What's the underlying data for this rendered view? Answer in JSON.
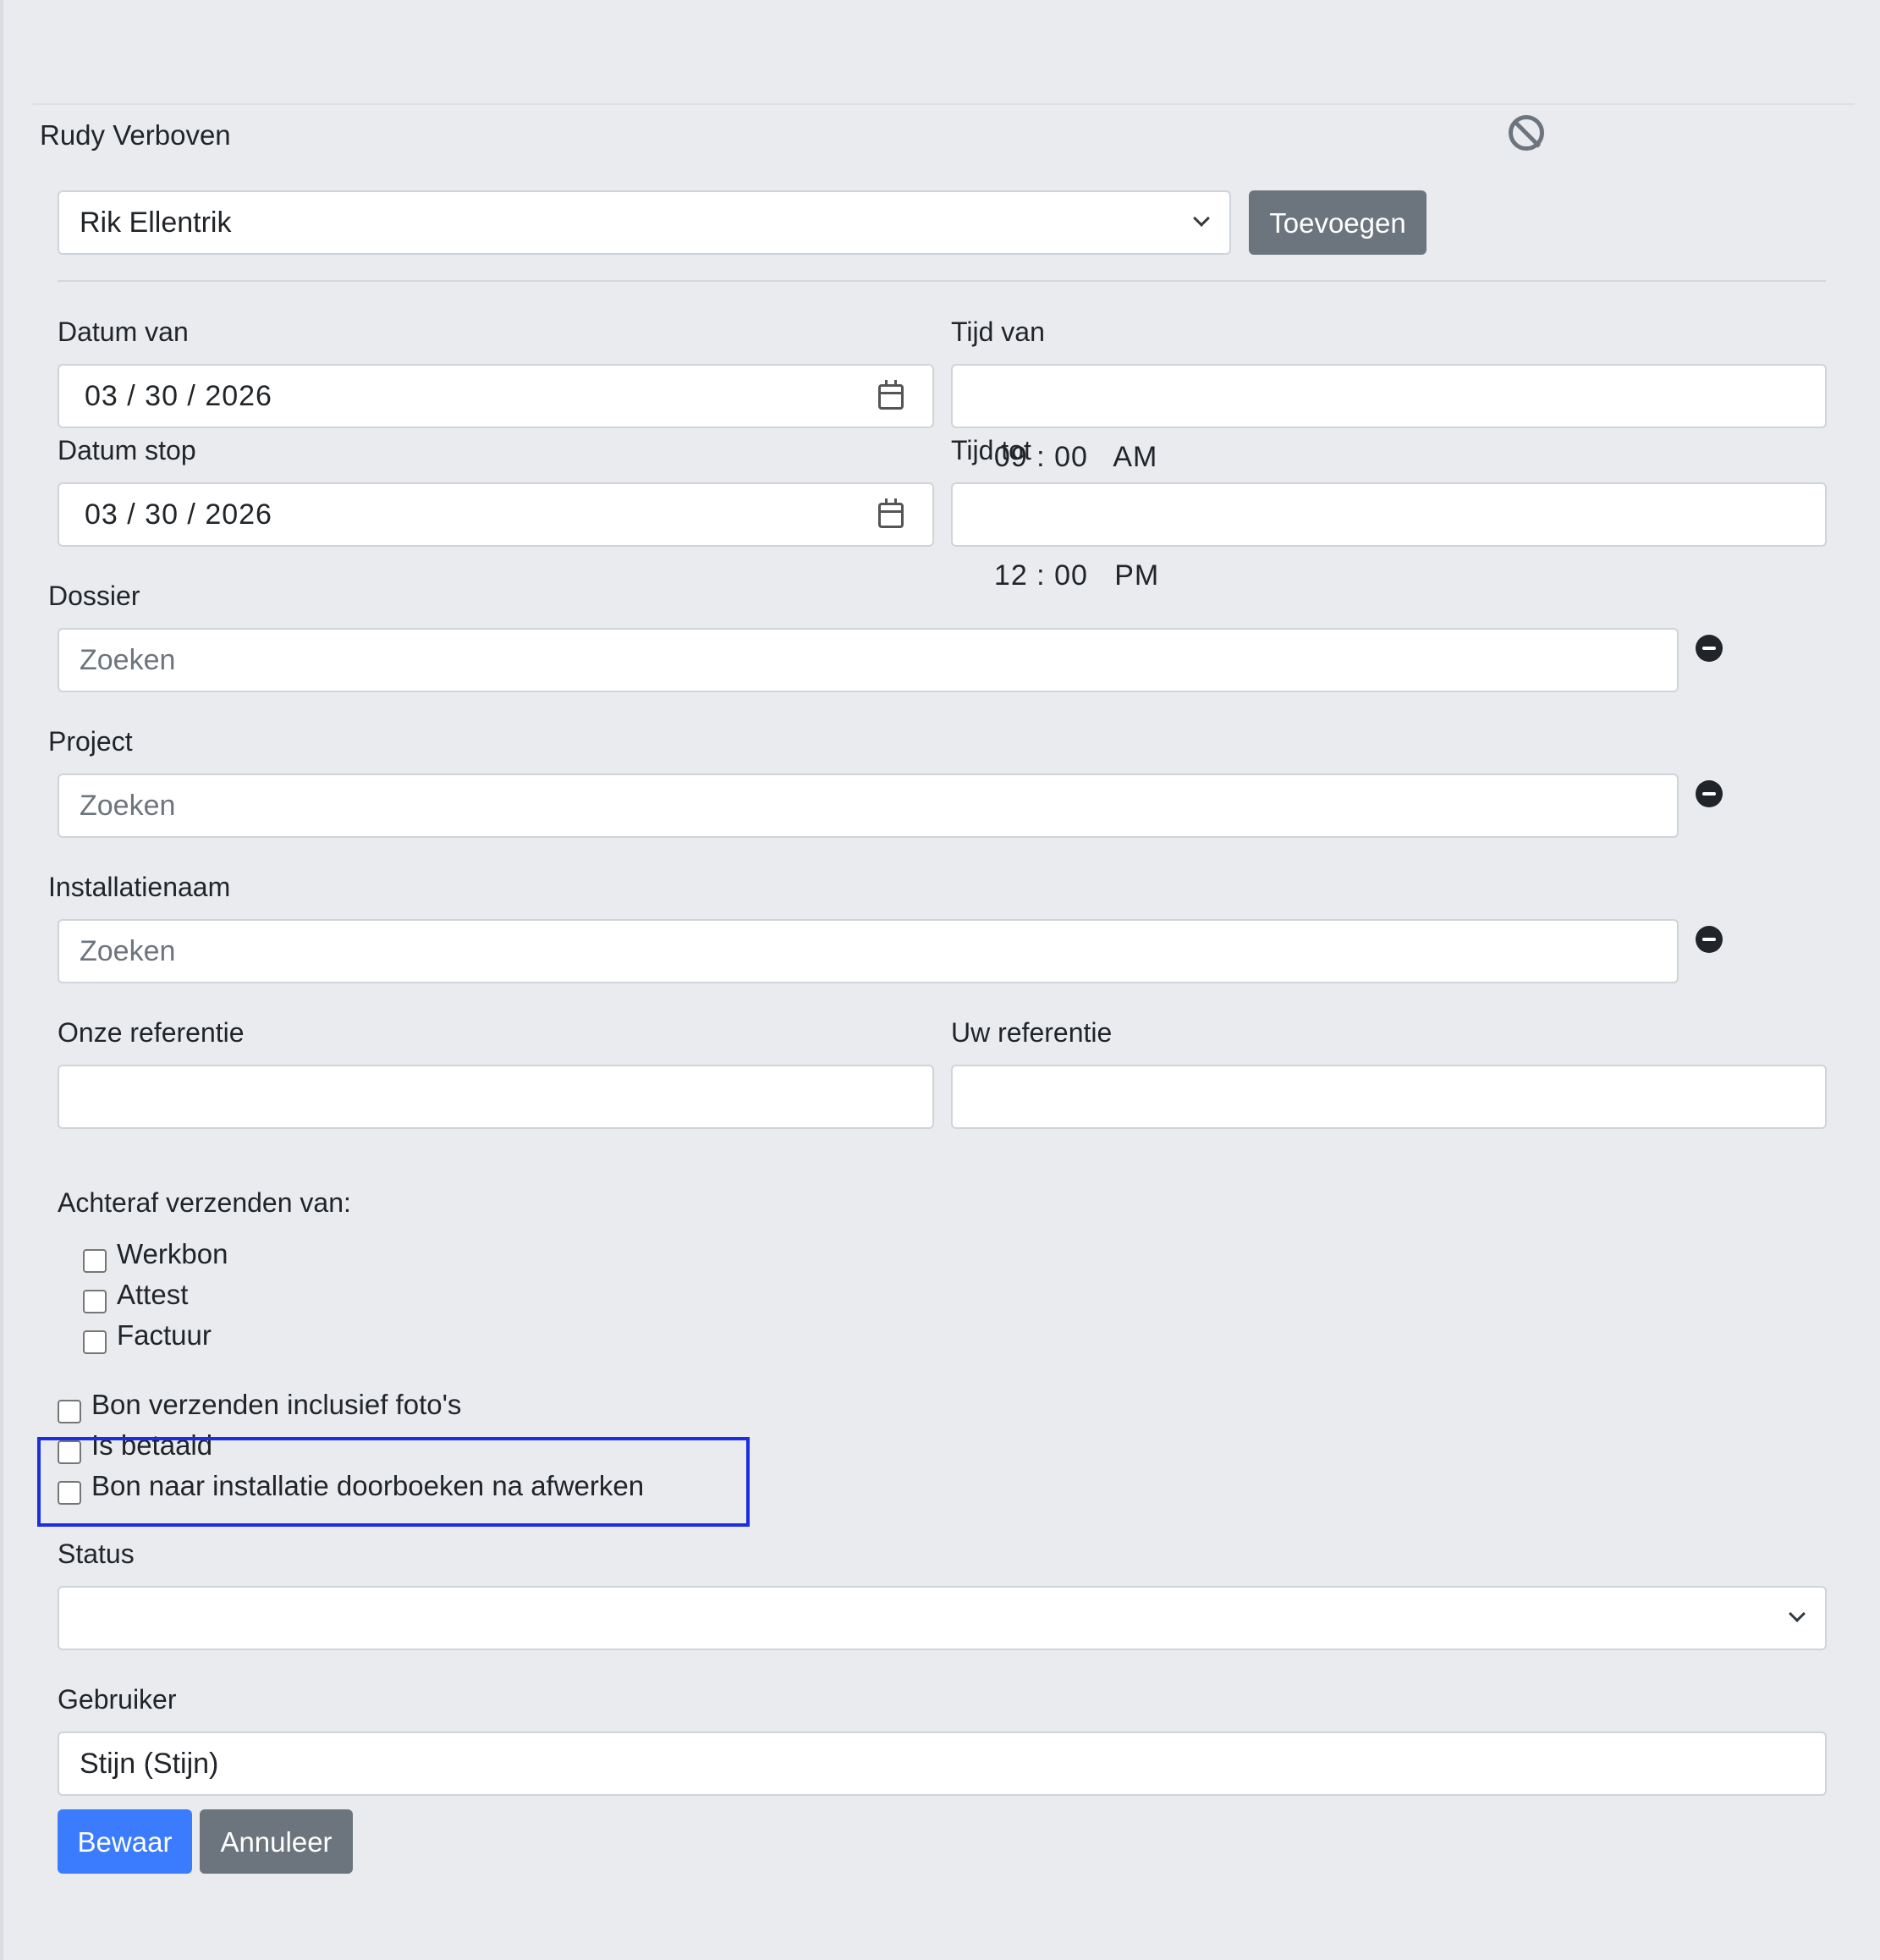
{
  "header": {
    "person_name": "Rudy Verboven"
  },
  "assign": {
    "selected_person": "Rik Ellentrik",
    "add_button": "Toevoegen"
  },
  "dates": {
    "from_label": "Datum van",
    "from_value": "03 / 30 / 2026",
    "time_from_label": "Tijd van",
    "time_from_value": "09 : 00   AM",
    "stop_label": "Datum stop",
    "stop_value": "03 / 30 / 2026",
    "time_to_label": "Tijd tot",
    "time_to_value": "12 : 00   PM"
  },
  "dossier": {
    "label": "Dossier",
    "placeholder": "Zoeken"
  },
  "project": {
    "label": "Project",
    "placeholder": "Zoeken"
  },
  "installation": {
    "label": "Installatienaam",
    "placeholder": "Zoeken"
  },
  "references": {
    "ours_label": "Onze referentie",
    "ours_value": "",
    "yours_label": "Uw referentie",
    "yours_value": ""
  },
  "send_after": {
    "label": "Achteraf verzenden van:",
    "options": [
      "Werkbon",
      "Attest",
      "Factuur"
    ]
  },
  "flags": {
    "photos": "Bon verzenden inclusief foto's",
    "paid": "Is betaald",
    "book": "Bon naar installatie doorboeken na afwerken"
  },
  "status": {
    "label": "Status",
    "value": ""
  },
  "user": {
    "label": "Gebruiker",
    "value": "Stijn (Stijn)"
  },
  "actions": {
    "save": "Bewaar",
    "cancel": "Annuleer"
  },
  "colors": {
    "primary": "#3b7cff",
    "secondary": "#6c757d",
    "highlight": "#1b2fe0",
    "background": "#e9ebef"
  },
  "icons": {
    "remove": "minus-circle-icon",
    "block": "ban-icon",
    "calendar": "calendar-icon"
  }
}
